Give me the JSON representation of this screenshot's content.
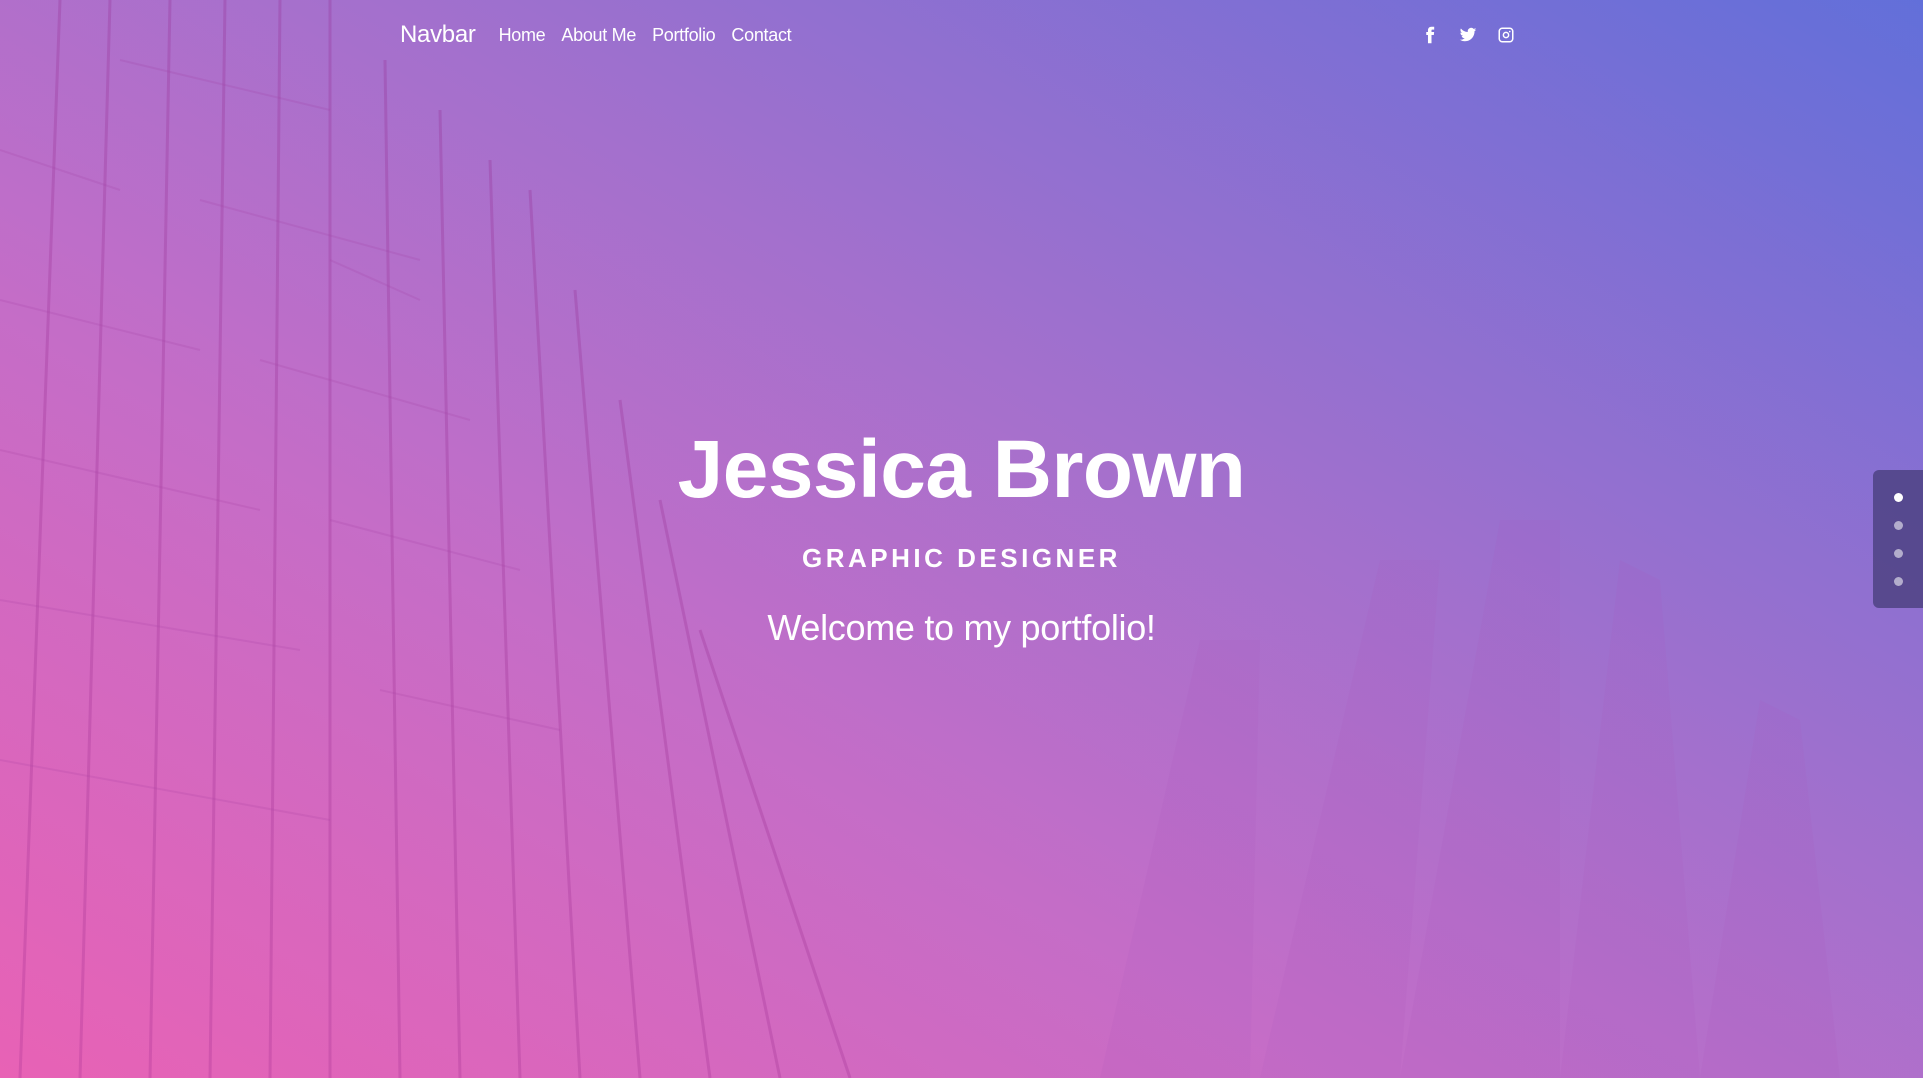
{
  "navbar": {
    "brand": "Navbar",
    "links": [
      {
        "label": "Home"
      },
      {
        "label": "About Me"
      },
      {
        "label": "Portfolio"
      },
      {
        "label": "Contact"
      }
    ],
    "social_icons": [
      "facebook-icon",
      "twitter-icon",
      "instagram-icon"
    ]
  },
  "hero": {
    "title": "Jessica Brown",
    "subtitle": "GRAPHIC DESIGNER",
    "tagline": "Welcome to my portfolio!"
  },
  "slide_dots": {
    "count": 4,
    "active_index": 0
  },
  "colors": {
    "gradient_pink": "#e866b8",
    "gradient_purple": "#a472cc",
    "gradient_blue": "#6470d8",
    "text": "#ffffff"
  }
}
